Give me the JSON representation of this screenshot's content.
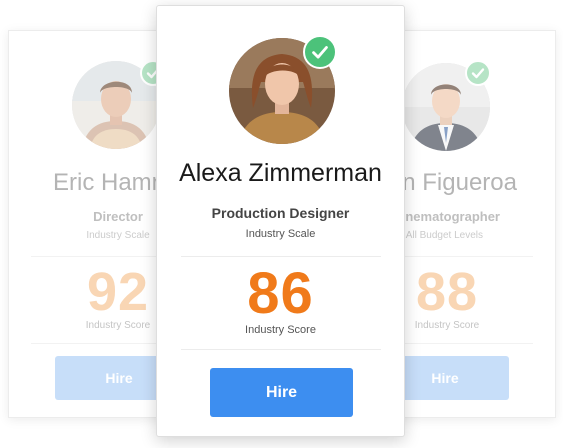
{
  "cards": {
    "left": {
      "name": "Eric Hamn",
      "role": "Director",
      "scale": "Industry Scale",
      "score": "92",
      "score_label": "Industry Score",
      "button_label": "Hire",
      "verified_icon": "check-icon"
    },
    "center": {
      "name": "Alexa Zimmerman",
      "role": "Production Designer",
      "scale": "Industry Scale",
      "score": "86",
      "score_label": "Industry  Score",
      "button_label": "Hire",
      "verified_icon": "check-icon"
    },
    "right": {
      "name": "an Figueroa",
      "role": "nematographer",
      "scale": "All Budget Levels",
      "score": "88",
      "score_label": "Industry  Score",
      "button_label": "Hire",
      "verified_icon": "check-icon"
    }
  },
  "colors": {
    "accent_orange": "#f07a1a",
    "accent_blue": "#3d8ef0",
    "verified_green": "#4cc27a"
  }
}
